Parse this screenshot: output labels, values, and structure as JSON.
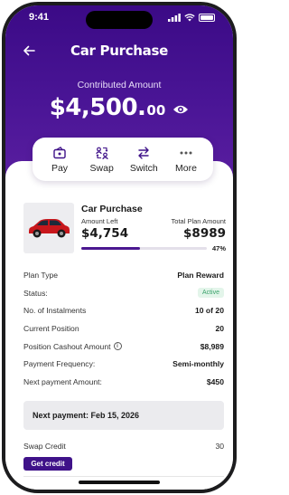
{
  "status_bar": {
    "time": "9:41"
  },
  "header": {
    "title": "Car Purchase",
    "contributed_label": "Contributed Amount",
    "amount_main": "$4,500.",
    "amount_cents": "00"
  },
  "actions": [
    {
      "label": "Pay",
      "icon": "wallet-icon"
    },
    {
      "label": "Swap",
      "icon": "swap-users-icon"
    },
    {
      "label": "Switch",
      "icon": "switch-arrows-icon"
    },
    {
      "label": "More",
      "icon": "more-dots-icon"
    }
  ],
  "plan": {
    "name": "Car Purchase",
    "amount_left_label": "Amount Left",
    "amount_left": "$4,754",
    "total_label": "Total Plan Amount",
    "total": "$8989",
    "progress_pct": "47%",
    "progress_fraction": 0.47
  },
  "details": [
    {
      "label": "Plan Type",
      "value": "Plan Reward"
    },
    {
      "label": "Status:",
      "value": "Active"
    },
    {
      "label": "No. of Instalments",
      "value": "10 of 20"
    },
    {
      "label": "Current Position",
      "value": "20"
    },
    {
      "label": "Position Cashout Amount",
      "value": "$8,989"
    },
    {
      "label": "Payment Frequency:",
      "value": "Semi-monthly"
    },
    {
      "label": "Next payment Amount:",
      "value": "$450"
    }
  ],
  "next_payment": "Next payment: Feb 15, 2026",
  "swap_credit": {
    "label": "Swap Credit",
    "value": "30",
    "button": "Get credit"
  },
  "colors": {
    "primary": "#3f1289",
    "hero_top": "#3b0a86",
    "active_badge_bg": "#e3f5ea",
    "active_badge_text": "#3aa26b"
  }
}
